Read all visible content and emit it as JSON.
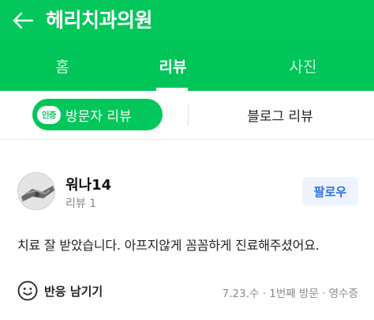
{
  "appbar": {
    "title": "헤리치과의원"
  },
  "tabs": [
    {
      "label": "홈"
    },
    {
      "label": "리뷰"
    },
    {
      "label": "사진"
    }
  ],
  "subtabs": {
    "badge_text": "인증",
    "visitor_review": "방문자 리뷰",
    "blog_review": "블로그 리뷰"
  },
  "review": {
    "username": "워나14",
    "review_count": "리뷰 1",
    "follow_label": "팔로우",
    "text": "치료 잘 받았습니다. 아프지않게 꼼꼼하게 진료해주셨어요.",
    "react_label": "반응 남기기",
    "meta": "7.23.수 · 1번째 방문 · 영수증"
  },
  "colors": {
    "brand_green": "#03c75a",
    "follow_blue": "#2f6fe4"
  }
}
